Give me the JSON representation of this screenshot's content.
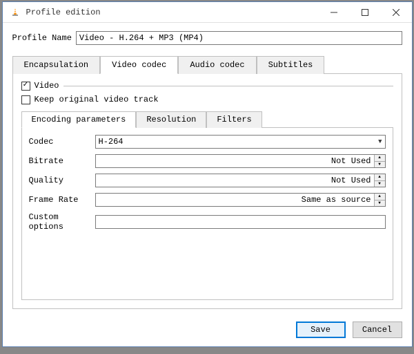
{
  "window": {
    "title": "Profile edition"
  },
  "profile": {
    "name_label": "Profile Name",
    "name_value": "Video - H.264 + MP3 (MP4)"
  },
  "tabs_outer": {
    "encapsulation": "Encapsulation",
    "video_codec": "Video codec",
    "audio_codec": "Audio codec",
    "subtitles": "Subtitles",
    "active": "video_codec"
  },
  "video_tab": {
    "video_checkbox_label": "Video",
    "video_checked": true,
    "keep_orig_label": "Keep original video track",
    "keep_orig_checked": false
  },
  "tabs_inner": {
    "encoding": "Encoding parameters",
    "resolution": "Resolution",
    "filters": "Filters",
    "active": "encoding"
  },
  "encoding": {
    "codec_label": "Codec",
    "codec_value": "H-264",
    "bitrate_label": "Bitrate",
    "bitrate_value": "Not Used",
    "quality_label": "Quality",
    "quality_value": "Not Used",
    "framerate_label": "Frame Rate",
    "framerate_value": "Same as source",
    "custom_label": "Custom options",
    "custom_value": ""
  },
  "footer": {
    "save_label": "Save",
    "cancel_label": "Cancel"
  }
}
